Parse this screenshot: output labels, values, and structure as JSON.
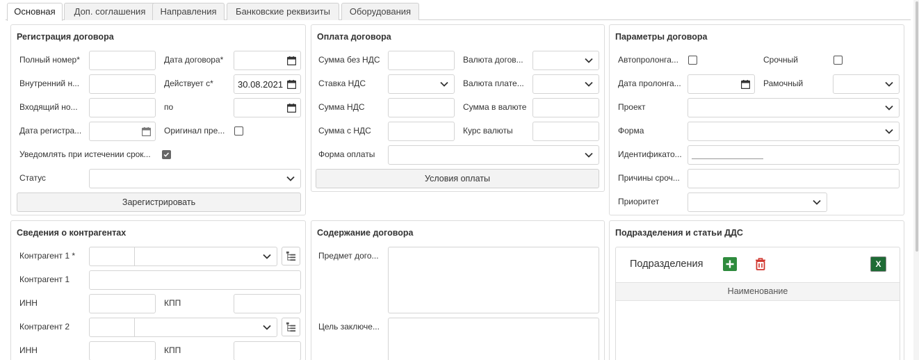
{
  "tabs": [
    {
      "label": "Основная",
      "active": true
    },
    {
      "label": "Доп. соглашения"
    },
    {
      "label": "Направления"
    },
    {
      "label": "Банковские реквизиты"
    },
    {
      "label": "Оборудования"
    }
  ],
  "registration": {
    "title": "Регистрация договора",
    "full_number_label": "Полный номер*",
    "contract_date_label": "Дата договора*",
    "internal_number_label": "Внутренний н...",
    "valid_from_label": "Действует с*",
    "valid_from_value": "30.08.2021",
    "incoming_number_label": "Входящий но...",
    "valid_to_label": "по",
    "registration_date_label": "Дата регистра...",
    "original_label": "Оригинал пре...",
    "notify_label": "Уведомлять при истечении срок...",
    "status_label": "Статус",
    "register_button": "Зарегистрировать"
  },
  "payment": {
    "title": "Оплата договора",
    "amount_no_vat_label": "Сумма без НДС",
    "contract_currency_label": "Валюта догов...",
    "vat_rate_label": "Ставка НДС",
    "payment_currency_label": "Валюта плате...",
    "vat_amount_label": "Сумма НДС",
    "amount_in_currency_label": "Сумма в валюте",
    "amount_with_vat_label": "Сумма с НДС",
    "exchange_rate_label": "Курс валюты",
    "payment_form_label": "Форма оплаты",
    "terms_button": "Условия оплаты"
  },
  "parameters": {
    "title": "Параметры договора",
    "auto_prolong_label": "Автопролонга...",
    "urgent_label": "Срочный",
    "prolong_date_label": "Дата пролонга...",
    "frame_label": "Рамочный",
    "project_label": "Проект",
    "form_label": "Форма",
    "identifier_label": "Идентификато...",
    "urgency_reasons_label": "Причины сроч...",
    "priority_label": "Приоритет"
  },
  "counterparties": {
    "title": "Сведения о контрагентах",
    "cp1_required_label": "Контрагент 1 *",
    "cp1_label": "Контрагент 1",
    "inn1_label": "ИНН",
    "kpp1_label": "КПП",
    "cp2_label": "Контрагент 2",
    "inn2_label": "ИНН",
    "kpp2_label": "КПП"
  },
  "content": {
    "title": "Содержание договора",
    "subject_label": "Предмет дого...",
    "purpose_label": "Цель заключе..."
  },
  "departments": {
    "title": "Подразделения и статьи ДДС",
    "subtitle": "Подразделения",
    "excel_label": "X",
    "column_name": "Наименование"
  },
  "colors": {
    "add_button": "#2e8b3d",
    "delete_icon": "#d0342c",
    "excel_button": "#1e6b35"
  }
}
